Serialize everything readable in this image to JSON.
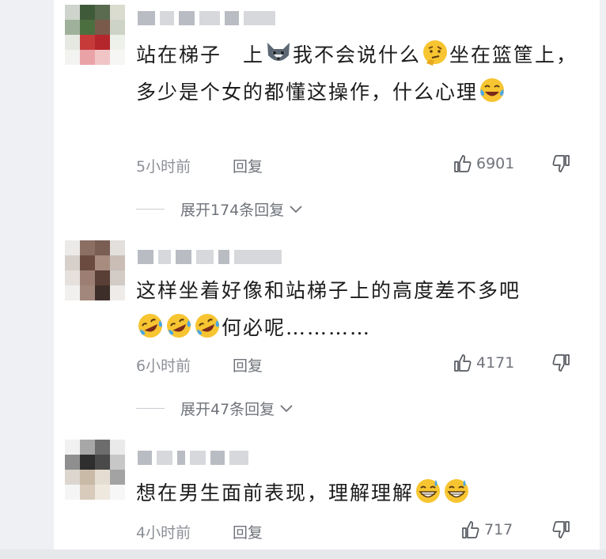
{
  "comments": [
    {
      "text_1": "站在梯子　上",
      "emoji_1": "wolf-face-emoji",
      "text_2": "我不会说什么",
      "emoji_2": "thinking-face-emoji",
      "text_3": "坐在篮筐上，多少是个女的都懂这操作，什么心理",
      "emoji_3": "tears-of-joy-emoji",
      "time": "5小时前",
      "reply_label": "回复",
      "likes": "6901",
      "expand_label": "展开174条回复"
    },
    {
      "text_1": "这样坐着好像和站梯子上的高度差不多吧",
      "emoji_1": "rofl-emoji",
      "emoji_2": "rofl-emoji",
      "emoji_3": "rofl-emoji",
      "text_2": "何必呢…………",
      "time": "6小时前",
      "reply_label": "回复",
      "likes": "4171",
      "expand_label": "展开47条回复"
    },
    {
      "text_1": "想在男生面前表现，理解理解",
      "emoji_1": "grinning-sweat-emoji",
      "emoji_2": "grinning-sweat-emoji",
      "time": "4小时前",
      "reply_label": "回复",
      "likes": "717"
    }
  ],
  "colors": {
    "text": "#1c1c1c",
    "meta": "#8b8f96",
    "emoji_yellow": "#f7c531",
    "tear_blue": "#4aa7e6"
  }
}
